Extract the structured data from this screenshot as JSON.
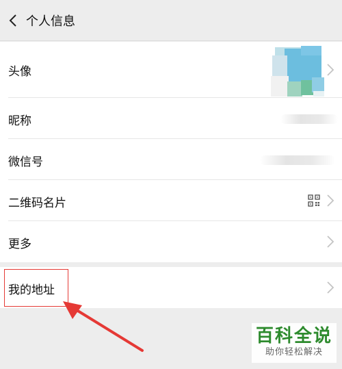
{
  "header": {
    "title": "个人信息",
    "back_icon": "chevron-left-icon"
  },
  "profile": {
    "rows": [
      {
        "label": "头像",
        "value_visible": false
      },
      {
        "label": "昵称",
        "value_visible": false
      },
      {
        "label": "微信号",
        "value_visible": false
      },
      {
        "label": "二维码名片",
        "trailing_icon": "qr-code-icon"
      },
      {
        "label": "更多"
      }
    ]
  },
  "address": {
    "label": "我的地址"
  },
  "annotation": {
    "color": "#e53935"
  },
  "watermark": {
    "title": "百科全说",
    "subtitle": "助你轻松解决",
    "color": "#2e8b2e"
  }
}
